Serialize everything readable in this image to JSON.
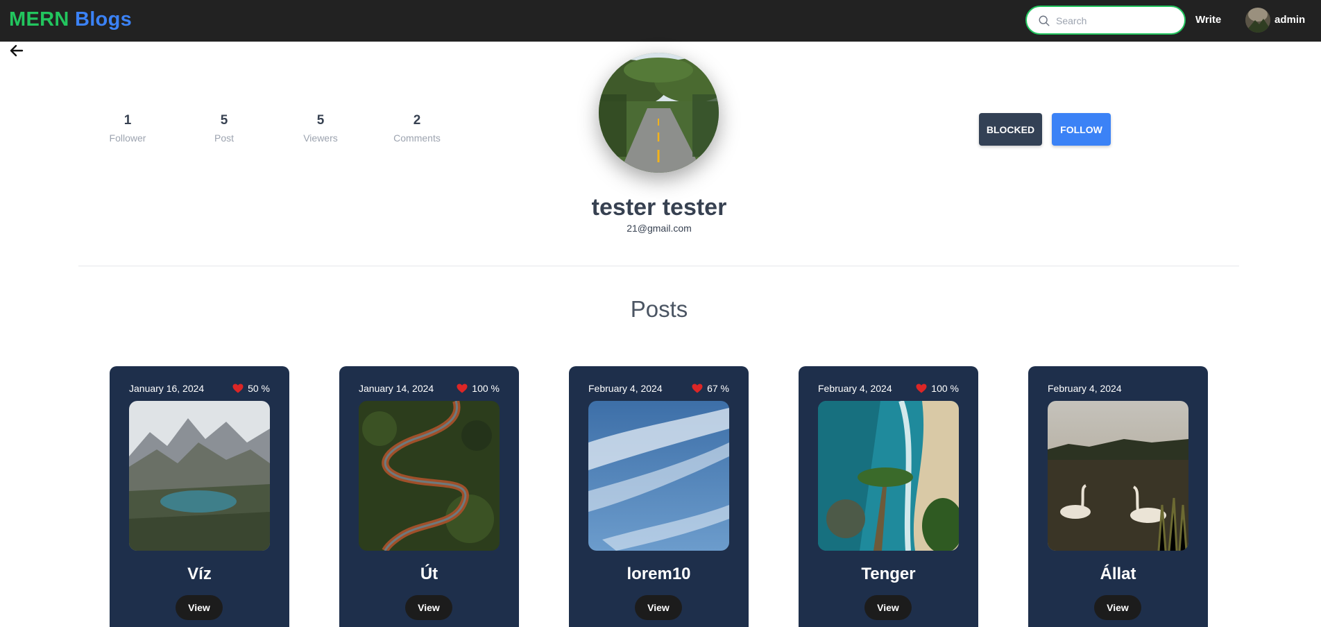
{
  "navbar": {
    "brand_part1": "MERN",
    "brand_part2": "Blogs",
    "search_placeholder": "Search",
    "write_label": "Write",
    "user_name": "admin"
  },
  "stats": [
    {
      "value": "1",
      "label": "Follower"
    },
    {
      "value": "5",
      "label": "Post"
    },
    {
      "value": "5",
      "label": "Viewers"
    },
    {
      "value": "2",
      "label": "Comments"
    }
  ],
  "profile": {
    "name": "tester tester",
    "email": "21@gmail.com"
  },
  "actions": {
    "blocked_label": "BLOCKED",
    "follow_label": "FOLLOW"
  },
  "section_title": "Posts",
  "posts": [
    {
      "date": "January 16, 2024",
      "likes": "50 %",
      "title": "Víz",
      "view_label": "View",
      "image": "mountain-lake"
    },
    {
      "date": "January 14, 2024",
      "likes": "100 %",
      "title": "Út",
      "view_label": "View",
      "image": "winding-road-forest"
    },
    {
      "date": "February 4, 2024",
      "likes": "67 %",
      "title": "lorem10",
      "view_label": "View",
      "image": "blue-sky-clouds"
    },
    {
      "date": "February 4, 2024",
      "likes": "100 %",
      "title": "Tenger",
      "view_label": "View",
      "image": "tropical-beach"
    },
    {
      "date": "February 4, 2024",
      "likes": "",
      "title": "Állat",
      "view_label": "View",
      "image": "swans-lake"
    }
  ],
  "colors": {
    "navbar_bg": "#222222",
    "brand_green": "#22c55e",
    "brand_blue": "#3b82f6",
    "card_bg": "#1e2f4b",
    "blocked_bg": "#334155",
    "follow_bg": "#3b82f6",
    "heart": "#dc2626"
  }
}
